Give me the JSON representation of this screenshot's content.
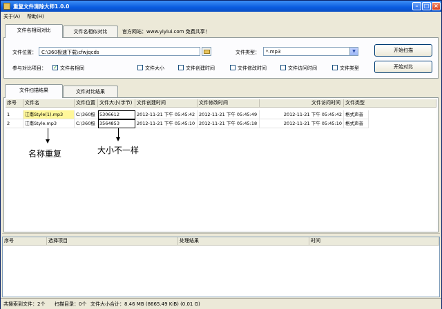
{
  "window": {
    "title": "重复文件清除大师1.0.0"
  },
  "menu": {
    "about": "关于(A)",
    "help": "帮助(H)"
  },
  "top_tabs": {
    "name_compare": "文件名相同对比",
    "similar_compare": "文件名相似对比",
    "website": "官方网站：www.yiyiui.com 免费共享！"
  },
  "form": {
    "location_label": "文件位置：",
    "location_value": "C:\\360极速下载\\cfwjqcds",
    "type_label": "文件类型：",
    "type_value": "*.mp3",
    "criteria_label": "参与对比项目：",
    "checks": [
      {
        "label": "文件名相同",
        "checked": true
      },
      {
        "label": "文件大小",
        "checked": false
      },
      {
        "label": "文件创建时间",
        "checked": false
      },
      {
        "label": "文件修改时间",
        "checked": false
      },
      {
        "label": "文件访问时间",
        "checked": false
      },
      {
        "label": "文件类型",
        "checked": false
      }
    ],
    "scan_button": "开始扫描",
    "compare_button": "开始对比"
  },
  "result_tabs": {
    "scan_result": "文件扫描结果",
    "compare_result": "文件对比结果"
  },
  "results": {
    "headers": [
      "序号",
      "文件名",
      "文件位置",
      "文件大小(字节)",
      "文件创建时间",
      "文件修改时间",
      "文件访问时间",
      "文件类型"
    ],
    "rows": [
      [
        "1",
        "江南Style(1).mp3",
        "C:\\360极",
        "5306612",
        "2012-11-21  下午 05:45:42",
        "2012-11-21  下午 05:45:49",
        "2012-11-21  下午 05:45:42",
        "格式声音"
      ],
      [
        "2",
        "江南Style.mp3",
        "C:\\360极",
        "3564853",
        "2012-11-21  下午 05:45:10",
        "2012-11-21  下午 05:45:18",
        "2012-11-21  下午 05:45:10",
        "格式声音"
      ]
    ]
  },
  "annotations": {
    "same_name": "名称重复",
    "diff_size": "大小不一样"
  },
  "log": {
    "headers": [
      "序号",
      "选择项目",
      "处理结果",
      "时间"
    ]
  },
  "status": {
    "found": "共搜索到文件：2个",
    "dirs": "扫描目录：0个",
    "total": "文件大小合计：8.46 MB (8665.49 KiB) (0.01 G)"
  }
}
